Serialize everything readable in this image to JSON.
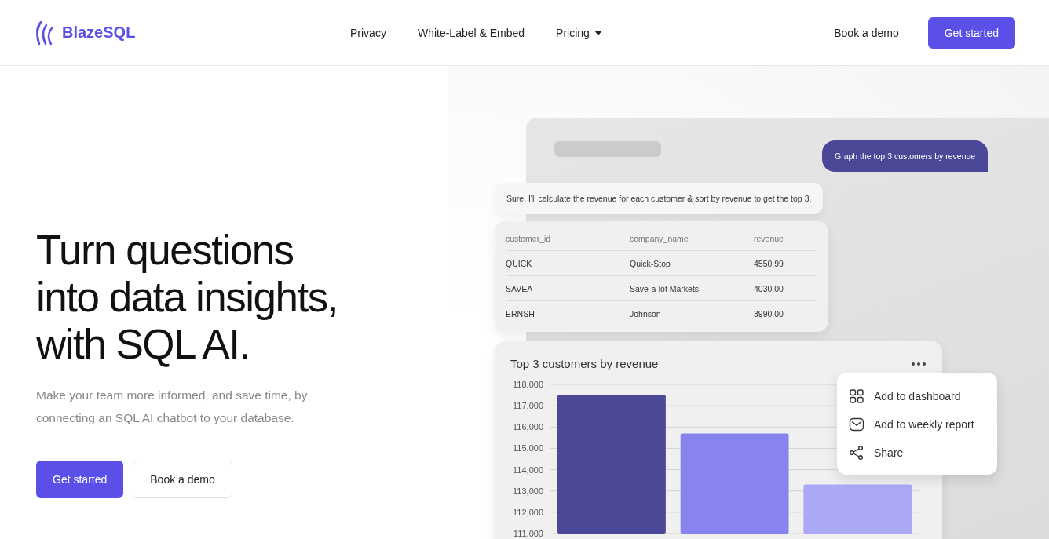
{
  "header": {
    "logo": "BlazeSQL",
    "nav": [
      {
        "label": "Privacy",
        "kind": "link"
      },
      {
        "label": "White-Label & Embed",
        "kind": "link"
      },
      {
        "label": "Pricing",
        "kind": "dropdown"
      }
    ],
    "demo_link": "Book a demo",
    "cta": "Get started"
  },
  "hero": {
    "title": "Turn questions into data insights, with SQL AI.",
    "subtitle": "Make your team more informed, and save time, by connecting an SQL AI chatbot to your database.",
    "primary_button": "Get started",
    "secondary_button": "Book a demo"
  },
  "mockup": {
    "user_message": "Graph the top 3 customers by revenue",
    "assistant_message": "Sure, I'll calculate the revenue for each customer & sort by revenue to get the top 3.",
    "table": {
      "columns": [
        "customer_id",
        "company_name",
        "revenue"
      ],
      "rows": [
        [
          "QUICK",
          "Quick-Stop",
          "4550.99"
        ],
        [
          "SAVEA",
          "Save-a-lot Markets",
          "4030.00"
        ],
        [
          "ERNSH",
          "Johnson",
          "3990.00"
        ]
      ]
    },
    "chart": {
      "title": "Top 3 customers by revenue",
      "chart_data": {
        "type": "bar",
        "series": [
          {
            "color": "#4b4898",
            "values": [
              117500,
              null,
              null
            ]
          },
          {
            "color": "#8783ef",
            "values": [
              null,
              115700,
              null
            ]
          },
          {
            "color": "#aba8f5",
            "values": [
              null,
              null,
              113300
            ]
          }
        ],
        "stacked": true,
        "grid": true,
        "ylim": [
          111000,
          118000
        ],
        "yticks": [
          {
            "value": 111000,
            "label": "111,000"
          },
          {
            "value": 112000,
            "label": "112,000"
          },
          {
            "value": 113000,
            "label": "113,000"
          },
          {
            "value": 114000,
            "label": "114,000"
          },
          {
            "value": 115000,
            "label": "115,000"
          },
          {
            "value": 116000,
            "label": "116,000"
          },
          {
            "value": 117000,
            "label": "117,000"
          },
          {
            "value": 118000,
            "label": "118,000"
          }
        ]
      }
    },
    "menu": [
      {
        "label": "Add to dashboard",
        "kind": "dashboard"
      },
      {
        "label": "Add to weekly report",
        "kind": "report"
      },
      {
        "label": "Share",
        "kind": "share"
      }
    ]
  }
}
